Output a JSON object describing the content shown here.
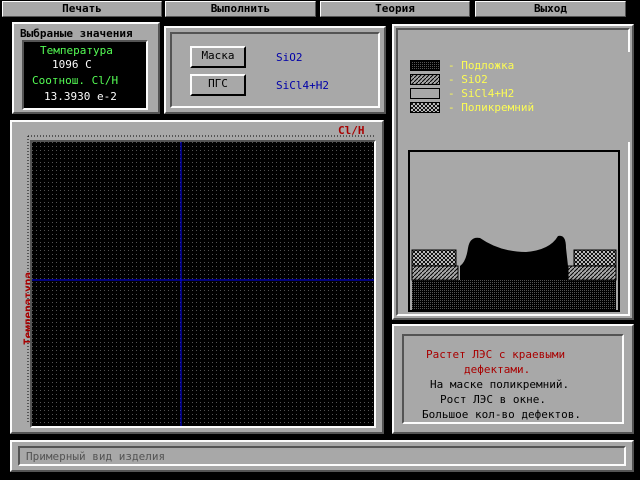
{
  "menu": {
    "print": "Печать",
    "run": "Выполнить",
    "theory": "Теория",
    "exit": "Выход"
  },
  "selected": {
    "title": "Выбраные значения",
    "temp_label": "Температура",
    "temp_value": "1096 C",
    "ratio_label": "Соотнош. Cl/H",
    "ratio_value": "13.3930 e-2"
  },
  "params": {
    "mask_label": "Маска",
    "mask_value": "SiO2",
    "pgs_label": "ПГС",
    "pgs_value": "SiCl4+H2"
  },
  "plot": {
    "x_label": "Cl/H",
    "y_label": "Температура"
  },
  "legend": [
    {
      "pattern": "dense",
      "label": "- Подложка"
    },
    {
      "pattern": "hatch",
      "label": "- SiO2"
    },
    {
      "pattern": "empty",
      "label": "- SiCl4+H2"
    },
    {
      "pattern": "cross",
      "label": "- Поликремний"
    }
  ],
  "message": {
    "line1": "Растет ЛЭС с краевыми",
    "line2": "дефектами.",
    "line3": "На маске поликремний.",
    "line4": "Рост ЛЭС в окне.",
    "line5": "Большое кол-во дефектов."
  },
  "status": {
    "text": "Примерный вид изделия"
  },
  "colors": {
    "panel": "#a8a8a8",
    "green": "#54fc54",
    "yellow": "#fcfc54",
    "red": "#a80000",
    "blue": "#0000a8"
  }
}
